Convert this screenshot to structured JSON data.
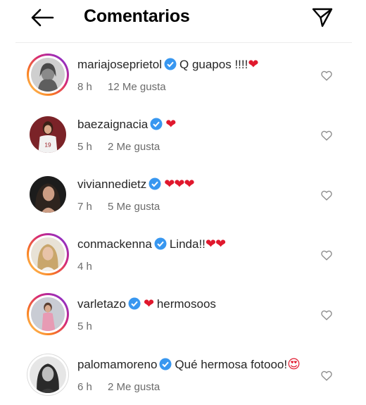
{
  "header": {
    "title": "Comentarios",
    "back_icon": "arrow-left-icon",
    "share_icon": "paper-plane-icon"
  },
  "colors": {
    "verified": "#3897f0",
    "heart": "#e0182d",
    "meta": "#6b6b6b"
  },
  "comments": [
    {
      "username": "mariajoseprietol",
      "text": "Q guapos !!!!",
      "emoji": "❤",
      "time": "8 h",
      "likes": "12 Me gusta",
      "ring": "story"
    },
    {
      "username": "baezaignacia",
      "text": "",
      "emoji": "❤",
      "time": "5 h",
      "likes": "2 Me gusta",
      "ring": "none"
    },
    {
      "username": "viviannedietz",
      "text": "",
      "emoji": "❤❤❤",
      "time": "7 h",
      "likes": "5 Me gusta",
      "ring": "none"
    },
    {
      "username": "conmackenna",
      "text": "Linda!!",
      "emoji": "❤❤",
      "time": "4 h",
      "likes": "",
      "ring": "story"
    },
    {
      "username": "varletazo",
      "text": "hermosoos",
      "emoji": "❤",
      "time": "5 h",
      "likes": "",
      "ring": "story"
    },
    {
      "username": "palomamoreno",
      "text": "Qué hermosa fotooo!",
      "emoji": "😍",
      "time": "6 h",
      "likes": "2 Me gusta",
      "ring": "seen"
    }
  ]
}
